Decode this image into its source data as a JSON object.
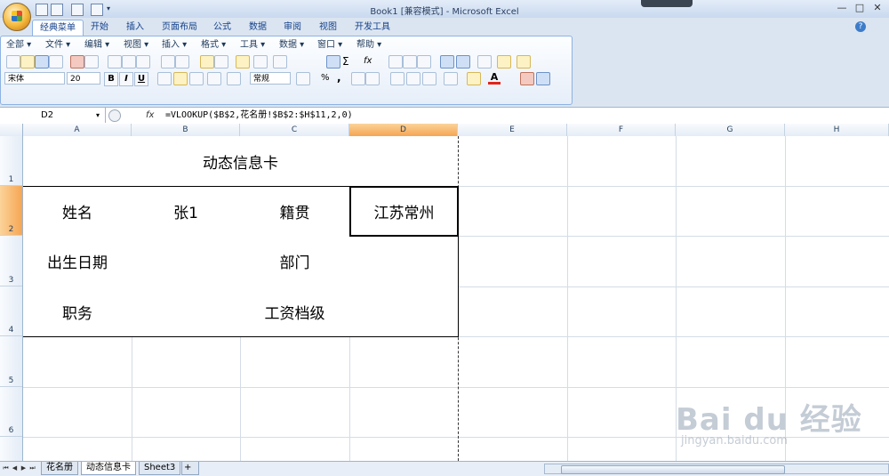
{
  "window": {
    "title": "Book1  [兼容模式] - Microsoft Excel",
    "controls": [
      "—",
      "□",
      "✕"
    ]
  },
  "ribbon": {
    "tabs": [
      "经典菜单",
      "开始",
      "插入",
      "页面布局",
      "公式",
      "数据",
      "审阅",
      "视图",
      "开发工具"
    ],
    "active_tab": "经典菜单",
    "menus": [
      "全部 ▾",
      "文件 ▾",
      "编辑 ▾",
      "视图 ▾",
      "插入 ▾",
      "格式 ▾",
      "工具 ▾",
      "数据 ▾",
      "窗口 ▾",
      "帮助 ▾"
    ],
    "font_name": "宋体",
    "font_size": "20",
    "bold": "B",
    "italic": "I",
    "underline": "U",
    "number_format": "常规",
    "percent": "%",
    "comma": ",",
    "sigma": "Σ",
    "fx": "fx"
  },
  "formula_bar": {
    "name_box": "D2",
    "fx_label": "fx",
    "formula": "=VLOOKUP($B$2,花名册!$B$2:$H$11,2,0)"
  },
  "sheet": {
    "columns": [
      "A",
      "B",
      "C",
      "D",
      "E",
      "F",
      "G",
      "H"
    ],
    "selected_column": "D",
    "rows": [
      "1",
      "2",
      "3",
      "4",
      "5",
      "6"
    ],
    "selected_row": "2",
    "cells": {
      "title": "动态信息卡",
      "a2": "姓名",
      "b2": "张1",
      "c2": "籍贯",
      "d2": "江苏常州",
      "a3": "出生日期",
      "b3": "",
      "c3": "部门",
      "d3": "",
      "a4": "职务",
      "b4": "",
      "c4": "工资档级",
      "d4": ""
    }
  },
  "sheet_tabs": {
    "tabs": [
      "花名册",
      "动态信息卡",
      "Sheet3"
    ],
    "active": "动态信息卡",
    "nav": [
      "⏮",
      "◀",
      "▶",
      "⏭"
    ]
  },
  "watermark": {
    "text": "Bai du 经验",
    "sub": "jingyan.baidu.com"
  }
}
